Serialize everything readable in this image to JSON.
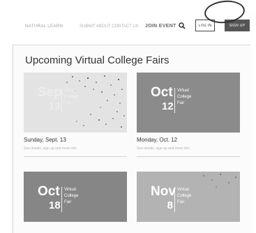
{
  "nav": {
    "logo": "NATURAL LEARN",
    "link": "SUBMIT  ABOUT  CONTACT US",
    "strong": "JOIN EVENT",
    "login": "LOG IN",
    "signup": "SIGN UP"
  },
  "section_title": "Upcoming Virtual College Fairs",
  "cards": [
    {
      "month": "Sep",
      "day": "13",
      "line1": "Virtual",
      "line2": "College",
      "line3": "Fair",
      "date": "Sunday, Sept. 13",
      "sub": "See details, sign up and more info",
      "bg": "#e4e4e4"
    },
    {
      "month": "Oct",
      "day": "12",
      "line1": "Virtual",
      "line2": "College",
      "line3": "Fair",
      "date": "Monday, Oct. 12",
      "sub": "See details, sign up and more info",
      "bg": "#8e8e8e"
    },
    {
      "month": "Oct",
      "day": "18",
      "line1": "Virtual",
      "line2": "College",
      "line3": "Fair",
      "date": "",
      "sub": "",
      "bg": "#858585"
    },
    {
      "month": "Nov",
      "day": "8",
      "line1": "Virtual",
      "line2": "College",
      "line3": "Fair",
      "date": "",
      "sub": "",
      "bg": "#b5b5b5"
    }
  ]
}
